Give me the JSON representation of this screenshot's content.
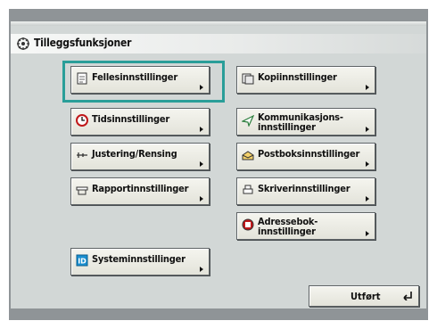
{
  "title": "Tilleggsfunksjoner",
  "buttons": {
    "fellesinnstillinger": "Fellesinnstillinger",
    "tidsinnstillinger": "Tidsinnstillinger",
    "justering": "Justering/Rensing",
    "rapportinnstillinger": "Rapportinnstillinger",
    "systeminnstillinger": "Systeminnstillinger",
    "kopiinnstillinger": "Kopiinnstillinger",
    "kommunikasjons": "Kommunikasjons-\ninnstillinger",
    "postboks": "Postboksinnstillinger",
    "skriver": "Skriverinnstillinger",
    "adressebok": "Adressebok-\ninnstillinger"
  },
  "done_label": "Utført",
  "icons": {
    "title": "gear-icon",
    "fellesinnstillinger": "document-icon",
    "tidsinnstillinger": "clock-icon",
    "justering": "adjust-icon",
    "rapportinnstillinger": "report-icon",
    "systeminnstillinger": "system-icon",
    "kopiinnstillinger": "copy-icon",
    "kommunikasjons": "communication-icon",
    "postboks": "mailbox-icon",
    "skriver": "printer-icon",
    "adressebok": "address-book-icon",
    "done": "enter-icon"
  },
  "colors": {
    "selected_outline": "#2a9e99",
    "screen_background": "#d2d7d6",
    "bezel": "#8f9497"
  }
}
